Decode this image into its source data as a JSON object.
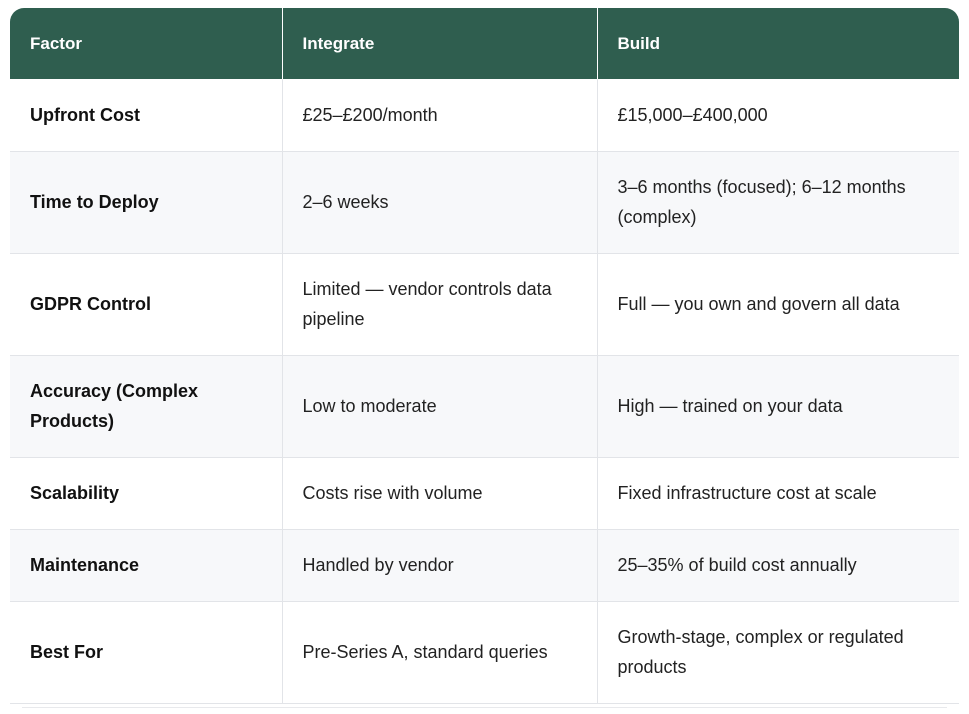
{
  "table": {
    "headers": [
      "Factor",
      "Integrate",
      "Build"
    ],
    "rows": [
      {
        "factor": "Upfront Cost",
        "integrate": "£25–£200/month",
        "build": "£15,000–£400,000"
      },
      {
        "factor": "Time to Deploy",
        "integrate": "2–6 weeks",
        "build": "3–6 months (focused); 6–12 months (complex)"
      },
      {
        "factor": "GDPR Control",
        "integrate": "Limited — vendor controls data pipeline",
        "build": "Full — you own and govern all data"
      },
      {
        "factor": "Accuracy (Complex Products)",
        "integrate": "Low to moderate",
        "build": "High — trained on your data"
      },
      {
        "factor": "Scalability",
        "integrate": "Costs rise with volume",
        "build": "Fixed infrastructure cost at scale"
      },
      {
        "factor": "Maintenance",
        "integrate": "Handled by vendor",
        "build": "25–35% of build cost annually"
      },
      {
        "factor": "Best For",
        "integrate": "Pre-Series A, standard queries",
        "build": "Growth-stage, complex or regulated products"
      }
    ]
  },
  "colors": {
    "header_bg": "#2f5e4f",
    "header_text": "#ffffff",
    "row_alt_bg": "#f7f8fa",
    "border": "#e2e4e8"
  }
}
